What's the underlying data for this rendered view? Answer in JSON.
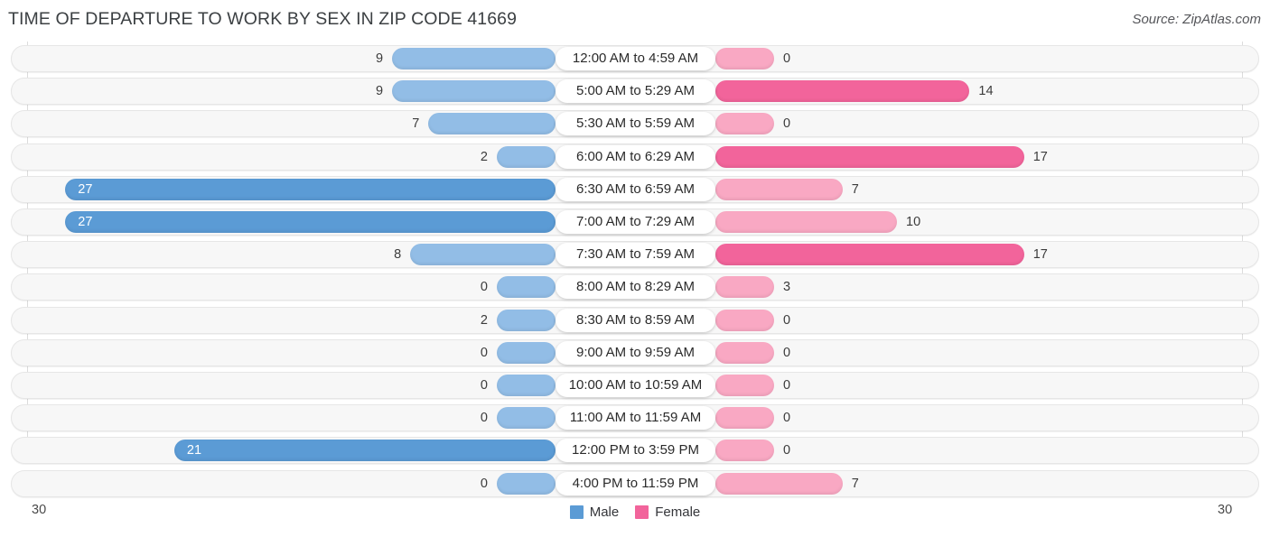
{
  "header": {
    "title": "TIME OF DEPARTURE TO WORK BY SEX IN ZIP CODE 41669",
    "source": "Source: ZipAtlas.com"
  },
  "legend": {
    "male_label": "Male",
    "female_label": "Female",
    "male_color": "#5B9BD5",
    "female_color": "#F2649B"
  },
  "axis": {
    "left_end": "30",
    "right_end": "30",
    "max": 30
  },
  "colors": {
    "male_dark": "#5B9BD5",
    "male_light": "#92BDE6",
    "female_dark": "#F2649B",
    "female_light": "#F9A8C3"
  },
  "chart_data": {
    "type": "bar",
    "title": "TIME OF DEPARTURE TO WORK BY SEX IN ZIP CODE 41669",
    "xlabel": "",
    "ylabel": "",
    "orientation": "horizontal-diverging",
    "xlim": [
      30,
      30
    ],
    "grid": true,
    "legend_position": "bottom-center",
    "categories": [
      "12:00 AM to 4:59 AM",
      "5:00 AM to 5:29 AM",
      "5:30 AM to 5:59 AM",
      "6:00 AM to 6:29 AM",
      "6:30 AM to 6:59 AM",
      "7:00 AM to 7:29 AM",
      "7:30 AM to 7:59 AM",
      "8:00 AM to 8:29 AM",
      "8:30 AM to 8:59 AM",
      "9:00 AM to 9:59 AM",
      "10:00 AM to 10:59 AM",
      "11:00 AM to 11:59 AM",
      "12:00 PM to 3:59 PM",
      "4:00 PM to 11:59 PM"
    ],
    "series": [
      {
        "name": "Male",
        "values": [
          9,
          9,
          7,
          2,
          27,
          27,
          8,
          0,
          2,
          0,
          0,
          0,
          21,
          0
        ]
      },
      {
        "name": "Female",
        "values": [
          0,
          14,
          0,
          17,
          7,
          10,
          17,
          3,
          0,
          0,
          0,
          0,
          0,
          7
        ]
      }
    ]
  },
  "rows": [
    {
      "label": "12:00 AM to 4:59 AM",
      "male": "9",
      "female": "0"
    },
    {
      "label": "5:00 AM to 5:29 AM",
      "male": "9",
      "female": "14"
    },
    {
      "label": "5:30 AM to 5:59 AM",
      "male": "7",
      "female": "0"
    },
    {
      "label": "6:00 AM to 6:29 AM",
      "male": "2",
      "female": "17"
    },
    {
      "label": "6:30 AM to 6:59 AM",
      "male": "27",
      "female": "7"
    },
    {
      "label": "7:00 AM to 7:29 AM",
      "male": "27",
      "female": "10"
    },
    {
      "label": "7:30 AM to 7:59 AM",
      "male": "8",
      "female": "17"
    },
    {
      "label": "8:00 AM to 8:29 AM",
      "male": "0",
      "female": "3"
    },
    {
      "label": "8:30 AM to 8:59 AM",
      "male": "2",
      "female": "0"
    },
    {
      "label": "9:00 AM to 9:59 AM",
      "male": "0",
      "female": "0"
    },
    {
      "label": "10:00 AM to 10:59 AM",
      "male": "0",
      "female": "0"
    },
    {
      "label": "11:00 AM to 11:59 AM",
      "male": "0",
      "female": "0"
    },
    {
      "label": "12:00 PM to 3:59 PM",
      "male": "21",
      "female": "0"
    },
    {
      "label": "4:00 PM to 11:59 PM",
      "male": "0",
      "female": "7"
    }
  ]
}
